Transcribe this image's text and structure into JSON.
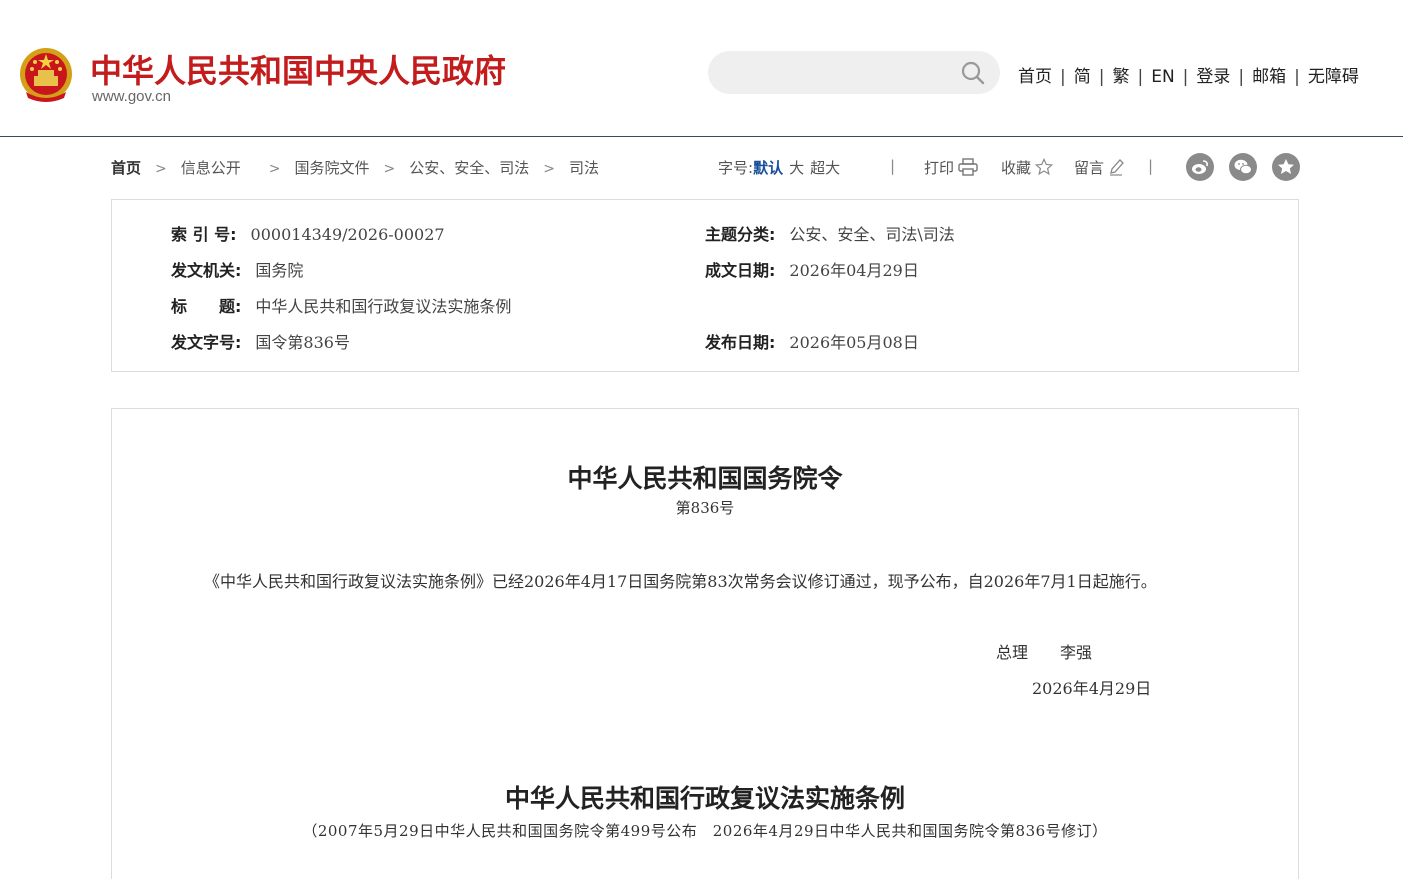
{
  "header": {
    "site_title": "中华人民共和国中央人民政府",
    "site_domain": "www.gov.cn",
    "search": {
      "placeholder": ""
    },
    "nav": [
      "首页",
      "简",
      "繁",
      "EN",
      "登录",
      "邮箱",
      "无障碍"
    ],
    "separator": "|"
  },
  "breadcrumb": {
    "items": [
      "首页",
      "信息公开",
      "国务院文件",
      "公安、安全、司法",
      "司法"
    ],
    "arrow": ">"
  },
  "toolbar": {
    "font_label": "字号:",
    "font_options": [
      "默认",
      "大",
      "超大"
    ],
    "font_active": "默认",
    "print_label": "打印",
    "favorite_label": "收藏",
    "comment_label": "留言",
    "separator": "|"
  },
  "info": {
    "index_label": "索 引 号:",
    "index_value": "000014349/2026-00027",
    "topic_label": "主题分类:",
    "topic_value": "公安、安全、司法\\司法",
    "issuer_label": "发文机关:",
    "issuer_value": "国务院",
    "written_label": "成文日期:",
    "written_value": "2026年04月29日",
    "title_label": "标　　题:",
    "title_value": "中华人民共和国行政复议法实施条例",
    "docno_label": "发文字号:",
    "docno_value": "国令第836号",
    "published_label": "发布日期:",
    "published_value": "2026年05月08日"
  },
  "content": {
    "order_title": "中华人民共和国国务院令",
    "order_number": "第836号",
    "paragraph": "《中华人民共和国行政复议法实施条例》已经2026年4月17日国务院第83次常务会议修订通过，现予公布，自2026年7月1日起施行。",
    "signatory": "总理　　李强",
    "sign_date": "2026年4月29日",
    "regulation_title": "中华人民共和国行政复议法实施条例",
    "regulation_note": "（2007年5月29日中华人民共和国国务院令第499号公布　2026年4月29日中华人民共和国国务院令第836号修订）"
  },
  "colors": {
    "brand_red": "#c31c1c",
    "active_blue": "#1a4f9c",
    "border_gray": "#dcdcdc"
  },
  "icons": [
    "emblem-icon",
    "search-icon",
    "print-icon",
    "star-icon",
    "pencil-icon",
    "weibo-icon",
    "wechat-icon",
    "favorite-star-icon"
  ]
}
